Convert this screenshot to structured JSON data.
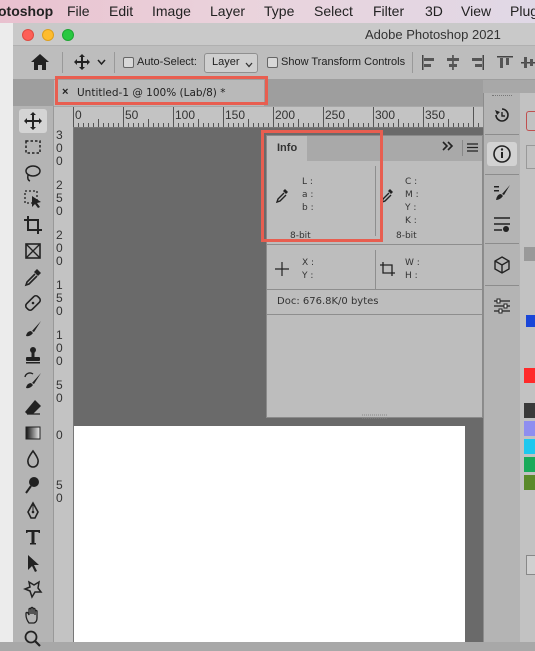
{
  "menubar": {
    "app": "otoshop",
    "items": [
      "File",
      "Edit",
      "Image",
      "Layer",
      "Type",
      "Select",
      "Filter",
      "3D",
      "View",
      "Plug"
    ]
  },
  "window": {
    "title": "Adobe Photoshop 2021"
  },
  "options": {
    "auto_select_label": "Auto-Select:",
    "auto_select_value": "Layer",
    "show_transform_label": "Show Transform Controls"
  },
  "document": {
    "tab_close": "×",
    "tab_title": "Untitled-1 @ 100% (Lab/8) *"
  },
  "ruler": {
    "h_ticks": [
      "0",
      "50",
      "100",
      "150",
      "200",
      "250",
      "300",
      "350"
    ],
    "v_ticks": [
      "3\n0\n0",
      "2\n5\n0",
      "2\n0\n0",
      "1\n5\n0",
      "1\n0\n0",
      "5\n0",
      "0",
      "5\n0"
    ]
  },
  "info_panel": {
    "tab": "Info",
    "lab_labels": "L :\na :\nb :",
    "cmyk_labels": "C :\nM :\nY :\nK :",
    "bit_left": "8-bit",
    "bit_right": "8-bit",
    "xy_labels": "X :\nY :",
    "wh_labels": "W :\nH :",
    "doc_info": "Doc: 676.8K/0 bytes"
  },
  "colors": {
    "accent_highlight": "#e85e50",
    "swatches": [
      "#ff2a2a",
      "#3a3a3a",
      "#8e8ef0",
      "#1ec8ee",
      "#1aaa5a",
      "#5a8a2a"
    ]
  }
}
